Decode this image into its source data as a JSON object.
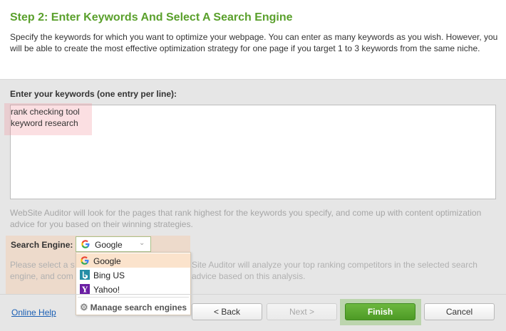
{
  "header": {
    "title": "Step 2: Enter Keywords And Select A Search Engine",
    "description": "Specify the keywords for which you want to optimize your webpage. You can enter as many keywords as you wish. However, you will be able to create the most effective optimization strategy for one page if you target 1 to 3 keywords from the same niche."
  },
  "keywords": {
    "label": "Enter your keywords (one entry per line):",
    "lines": [
      "rank checking tool",
      "keyword research"
    ],
    "help": "WebSite Auditor will look for the pages that rank highest for the keywords you specify, and come up with content optimization advice for you based on their winning strategies."
  },
  "search_engine": {
    "label": "Search Engine:",
    "selected": "Google",
    "help_part1": "Please select a s",
    "help_part2": "Site Auditor will analyze your top ranking competitors in the selected search",
    "help_part3": "engine, and com",
    "help_part4": "advice based on this analysis.",
    "options": [
      {
        "label": "Google",
        "icon": "google-icon"
      },
      {
        "label": "Bing US",
        "icon": "bing-icon"
      },
      {
        "label": "Yahoo!",
        "icon": "yahoo-icon"
      }
    ],
    "manage_label": "Manage search engines"
  },
  "footer": {
    "online_help": "Online Help",
    "back": "< Back",
    "next": "Next >",
    "finish": "Finish",
    "cancel": "Cancel"
  },
  "colors": {
    "title_green": "#5aa02c",
    "finish_green": "#4d9a25",
    "link_blue": "#1a5fb4"
  }
}
